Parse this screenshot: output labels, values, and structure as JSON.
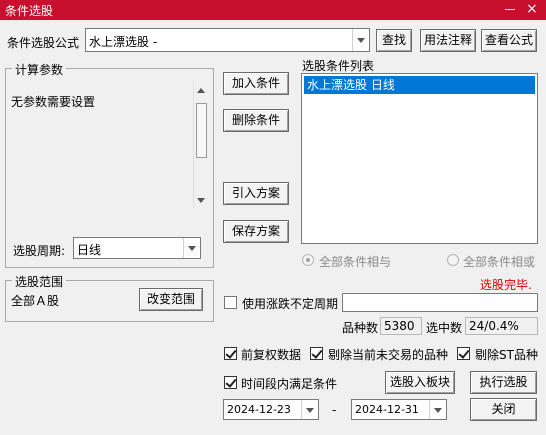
{
  "window": {
    "title": "条件选股",
    "close": "×"
  },
  "formula": {
    "label": "条件选股公式",
    "value": "水上漂选股   -",
    "find_button": "查找",
    "usage_button": "用法注释",
    "view_button": "查看公式"
  },
  "params": {
    "group_title": "计算参数",
    "text": "无参数需要设置",
    "period_label": "选股周期:",
    "period_value": "日线"
  },
  "condition_buttons": {
    "add": "加入条件",
    "delete": "删除条件",
    "import": "引入方案",
    "save": "保存方案"
  },
  "condition_list": {
    "title": "选股条件列表",
    "items": [
      "水上漂选股  日线"
    ]
  },
  "logic": {
    "and_label": "全部条件相与",
    "or_label": "全部条件相或",
    "selected": "and"
  },
  "status": {
    "text": "选股完毕."
  },
  "range": {
    "group_title": "选股范围",
    "value": "全部Ａ股",
    "change_button": "改变范围"
  },
  "indefinite": {
    "label": "使用涨跌不定周期",
    "checked": false,
    "value": ""
  },
  "counts": {
    "species_label": "品种数",
    "species_value": "5380",
    "selected_label": "选中数",
    "selected_value": "24/0.4%"
  },
  "options": {
    "forward_adjust": {
      "label": "前复权数据",
      "checked": true
    },
    "exclude_untraded": {
      "label": "剔除当前未交易的品种",
      "checked": true
    },
    "exclude_st": {
      "label": "剔除ST品种",
      "checked": true
    },
    "period_satisfy": {
      "label": "时间段内满足条件",
      "checked": true
    }
  },
  "dates": {
    "start": "2024-12-23",
    "separator": "-",
    "end": "2024-12-31"
  },
  "actions": {
    "to_block": "选股入板块",
    "execute": "执行选股",
    "close": "关闭"
  },
  "colors": {
    "titlebar": "#c8102e",
    "selection": "#0078d7",
    "status": "#e00000"
  }
}
